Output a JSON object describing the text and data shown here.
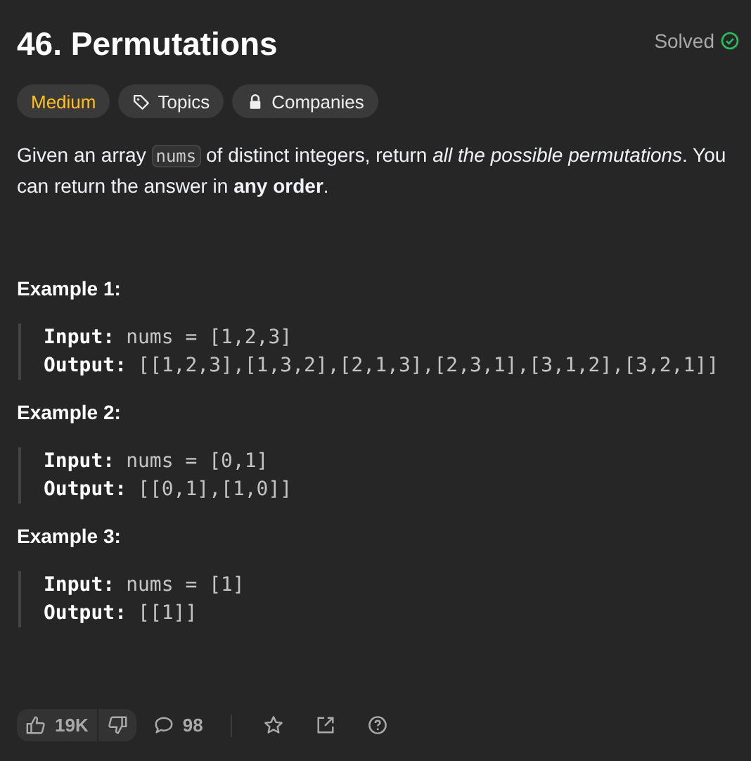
{
  "problem": {
    "title": "46. Permutations",
    "status": "Solved",
    "solved": true
  },
  "tags": [
    {
      "kind": "difficulty",
      "label": "Medium"
    },
    {
      "kind": "topics",
      "label": "Topics"
    },
    {
      "kind": "companies",
      "label": "Companies"
    }
  ],
  "description": [
    [
      {
        "kind": "text",
        "text": "Given an array "
      },
      {
        "kind": "code",
        "text": "nums"
      },
      {
        "kind": "text",
        "text": " of distinct integers, return *all the possible permutations*. You can return the answer in **any order**."
      }
    ]
  ],
  "examples": [
    {
      "heading": "Example 1:",
      "lines": [
        {
          "label": "Input:",
          "value": "nums = [1,2,3]"
        },
        {
          "label": "Output:",
          "value": "[[1,2,3],[1,3,2],[2,1,3],[2,3,1],[3,1,2],[3,2,1]]"
        }
      ]
    },
    {
      "heading": "Example 2:",
      "lines": [
        {
          "label": "Input:",
          "value": "nums = [0,1]"
        },
        {
          "label": "Output:",
          "value": "[[0,1],[1,0]]"
        }
      ]
    },
    {
      "heading": "Example 3:",
      "lines": [
        {
          "label": "Input:",
          "value": "nums = [1]"
        },
        {
          "label": "Output:",
          "value": "[[1]]"
        }
      ]
    }
  ],
  "footer": {
    "likes": "19K",
    "comments": "98"
  }
}
